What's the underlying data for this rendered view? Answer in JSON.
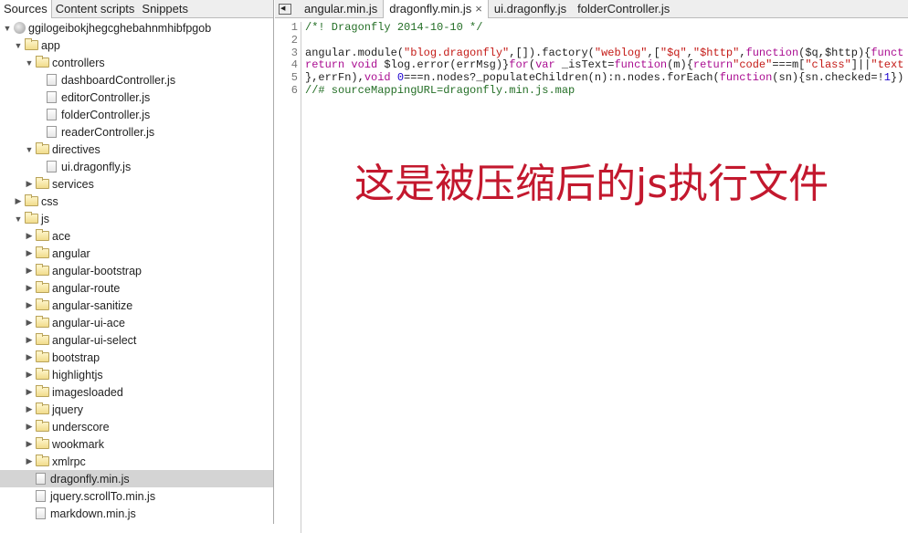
{
  "navigator": {
    "tabs": [
      "Sources",
      "Content scripts",
      "Snippets"
    ],
    "active_tab": 0,
    "tree": [
      {
        "label": "ggilogeibokjhegcghebahnmhibfpgob",
        "depth": 0,
        "type": "origin",
        "expanded": true
      },
      {
        "label": "app",
        "depth": 1,
        "type": "folder",
        "expanded": true
      },
      {
        "label": "controllers",
        "depth": 2,
        "type": "folder",
        "expanded": true
      },
      {
        "label": "dashboardController.js",
        "depth": 3,
        "type": "file"
      },
      {
        "label": "editorController.js",
        "depth": 3,
        "type": "file"
      },
      {
        "label": "folderController.js",
        "depth": 3,
        "type": "file"
      },
      {
        "label": "readerController.js",
        "depth": 3,
        "type": "file"
      },
      {
        "label": "directives",
        "depth": 2,
        "type": "folder",
        "expanded": true
      },
      {
        "label": "ui.dragonfly.js",
        "depth": 3,
        "type": "file"
      },
      {
        "label": "services",
        "depth": 2,
        "type": "folder",
        "expanded": false
      },
      {
        "label": "css",
        "depth": 1,
        "type": "folder",
        "expanded": false
      },
      {
        "label": "js",
        "depth": 1,
        "type": "folder",
        "expanded": true
      },
      {
        "label": "ace",
        "depth": 2,
        "type": "folder",
        "expanded": false
      },
      {
        "label": "angular",
        "depth": 2,
        "type": "folder",
        "expanded": false
      },
      {
        "label": "angular-bootstrap",
        "depth": 2,
        "type": "folder",
        "expanded": false
      },
      {
        "label": "angular-route",
        "depth": 2,
        "type": "folder",
        "expanded": false
      },
      {
        "label": "angular-sanitize",
        "depth": 2,
        "type": "folder",
        "expanded": false
      },
      {
        "label": "angular-ui-ace",
        "depth": 2,
        "type": "folder",
        "expanded": false
      },
      {
        "label": "angular-ui-select",
        "depth": 2,
        "type": "folder",
        "expanded": false
      },
      {
        "label": "bootstrap",
        "depth": 2,
        "type": "folder",
        "expanded": false
      },
      {
        "label": "highlightjs",
        "depth": 2,
        "type": "folder",
        "expanded": false
      },
      {
        "label": "imagesloaded",
        "depth": 2,
        "type": "folder",
        "expanded": false
      },
      {
        "label": "jquery",
        "depth": 2,
        "type": "folder",
        "expanded": false
      },
      {
        "label": "underscore",
        "depth": 2,
        "type": "folder",
        "expanded": false
      },
      {
        "label": "wookmark",
        "depth": 2,
        "type": "folder",
        "expanded": false
      },
      {
        "label": "xmlrpc",
        "depth": 2,
        "type": "folder",
        "expanded": false
      },
      {
        "label": "dragonfly.min.js",
        "depth": 2,
        "type": "file",
        "selected": true
      },
      {
        "label": "jquery.scrollTo.min.js",
        "depth": 2,
        "type": "file"
      },
      {
        "label": "markdown.min.js",
        "depth": 2,
        "type": "file"
      }
    ]
  },
  "editor": {
    "tabs": [
      {
        "label": "angular.min.js"
      },
      {
        "label": "dragonfly.min.js",
        "active": true,
        "close": "×"
      },
      {
        "label": "ui.dragonfly.js"
      },
      {
        "label": "folderController.js"
      }
    ],
    "lines": [
      [
        [
          "comment",
          "/*! Dragonfly 2014-10-10 */"
        ]
      ],
      [],
      [
        [
          "plain",
          "angular.module("
        ],
        [
          "string",
          "\"blog.dragonfly\""
        ],
        [
          "plain",
          ",[]).factory("
        ],
        [
          "string",
          "\"weblog\""
        ],
        [
          "plain",
          ",["
        ],
        [
          "string",
          "\"$q\""
        ],
        [
          "plain",
          ","
        ],
        [
          "string",
          "\"$http\""
        ],
        [
          "plain",
          ","
        ],
        [
          "keyword",
          "function"
        ],
        [
          "plain",
          "($q,$http){"
        ],
        [
          "keyword",
          "funct"
        ]
      ],
      [
        [
          "keyword",
          "return void"
        ],
        [
          "plain",
          " $log.error(errMsg)}"
        ],
        [
          "keyword",
          "for"
        ],
        [
          "plain",
          "("
        ],
        [
          "keyword",
          "var"
        ],
        [
          "plain",
          " _isText="
        ],
        [
          "keyword",
          "function"
        ],
        [
          "plain",
          "(m){"
        ],
        [
          "keyword",
          "return"
        ],
        [
          "string",
          "\"code\""
        ],
        [
          "plain",
          "===m["
        ],
        [
          "string",
          "\"class\""
        ],
        [
          "plain",
          "]||"
        ],
        [
          "string",
          "\"text"
        ]
      ],
      [
        [
          "plain",
          "},errFn),"
        ],
        [
          "keyword",
          "void"
        ],
        [
          "plain",
          " "
        ],
        [
          "number",
          "0"
        ],
        [
          "plain",
          "===n.nodes?_populateChildren(n):n.nodes.forEach("
        ],
        [
          "keyword",
          "function"
        ],
        [
          "plain",
          "(sn){sn.checked=!"
        ],
        [
          "number",
          "1"
        ],
        [
          "plain",
          "})"
        ]
      ],
      [
        [
          "comment",
          "//# sourceMappingURL=dragonfly.min.js.map"
        ]
      ]
    ]
  },
  "overlay_caption": "这是被压缩后的js执行文件"
}
